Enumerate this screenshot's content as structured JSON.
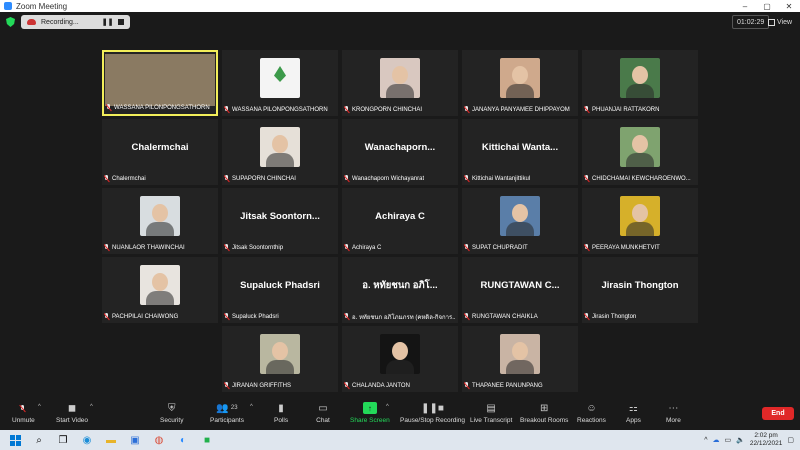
{
  "window": {
    "title": "Zoom Meeting"
  },
  "recording": {
    "label": "Recording..."
  },
  "meeting": {
    "timer": "01:02:29",
    "view_label": "View"
  },
  "participants": [
    {
      "name": "WASSANA PILONPONGSATHORN",
      "display": "",
      "photo": "wide",
      "active": true,
      "color": "#8a7a62"
    },
    {
      "name": "WASSANA PILONPONGSATHORN",
      "display": "",
      "photo": "logo",
      "active": false,
      "color": "#f4f4f4"
    },
    {
      "name": "KRONGPORN CHINCHAI",
      "display": "",
      "photo": "face",
      "active": false,
      "color": "#d9c8c0"
    },
    {
      "name": "JANANYA PANYAMEE DHIPPAYOM",
      "display": "",
      "photo": "face",
      "active": false,
      "color": "#cfa98c"
    },
    {
      "name": "PHUANJAI RATTAKORN",
      "display": "",
      "photo": "face",
      "active": false,
      "color": "#4a7a4a"
    },
    {
      "name": "Chalermchai",
      "display": "Chalermchai",
      "photo": "none",
      "active": false,
      "color": ""
    },
    {
      "name": "SUPAPORN CHINCHAI",
      "display": "",
      "photo": "face",
      "active": false,
      "color": "#e6e0d8"
    },
    {
      "name": "Wanachaporn Wichayanrat",
      "display": "Wanachaporn...",
      "photo": "none",
      "active": false,
      "color": ""
    },
    {
      "name": "Kittichai Wantanjittikul",
      "display": "Kittichai  Wanta...",
      "photo": "none",
      "active": false,
      "color": ""
    },
    {
      "name": "CHIDCHAMAI KEWCHAROENWO...",
      "display": "",
      "photo": "face",
      "active": false,
      "color": "#7fa36f"
    },
    {
      "name": "NUANLAOR THAWINCHAI",
      "display": "",
      "photo": "face",
      "active": false,
      "color": "#d8dde0"
    },
    {
      "name": "Jitsak Soontornthip",
      "display": "Jitsak  Soontorn...",
      "photo": "none",
      "active": false,
      "color": ""
    },
    {
      "name": "Achiraya C",
      "display": "Achiraya C",
      "photo": "none",
      "active": false,
      "color": ""
    },
    {
      "name": "SUPAT CHUPRADIT",
      "display": "",
      "photo": "face",
      "active": false,
      "color": "#5a7ea8"
    },
    {
      "name": "PEERAYA MUNKHETVIT",
      "display": "",
      "photo": "face",
      "active": false,
      "color": "#d6b02a"
    },
    {
      "name": "PACHPILAI CHAIWONG",
      "display": "",
      "photo": "face",
      "active": false,
      "color": "#e8e4df"
    },
    {
      "name": "Supaluck Phadsri",
      "display": "Supaluck  Phadsri",
      "photo": "none",
      "active": false,
      "color": ""
    },
    {
      "name": "อ. หทัยชนก อภิโภมภรท (คหดิล-กิจการ...",
      "display": "อ. หทัยชนก อภิโ...",
      "photo": "none",
      "active": false,
      "color": ""
    },
    {
      "name": "RUNGTAWAN CHAIKLA",
      "display": "RUNGTAWAN  C...",
      "photo": "none",
      "active": false,
      "color": ""
    },
    {
      "name": "Jirasin Thongton",
      "display": "Jirasin  Thongton",
      "photo": "none",
      "active": false,
      "color": ""
    },
    {
      "name": "JIRANAN GRIFFITHS",
      "display": "",
      "photo": "face",
      "active": false,
      "color": "#b9b7a0"
    },
    {
      "name": "CHALANDA JANTON",
      "display": "",
      "photo": "face",
      "active": false,
      "color": "#141414"
    },
    {
      "name": "THAPANEE PANUNPANG",
      "display": "",
      "photo": "face",
      "active": false,
      "color": "#c9b4a4"
    }
  ],
  "toolbar": {
    "unmute": "Unmute",
    "start_video": "Start Video",
    "security": "Security",
    "participants": "Participants",
    "participants_count": "23",
    "polls": "Polls",
    "chat": "Chat",
    "share_screen": "Share Screen",
    "pause_stop": "Pause/Stop Recording",
    "live_transcript": "Live Transcript",
    "breakout": "Breakout Rooms",
    "reactions": "Reactions",
    "apps": "Apps",
    "more": "More",
    "end": "End"
  },
  "taskbar": {
    "time": "2:02 pm",
    "date": "22/12/2021"
  }
}
